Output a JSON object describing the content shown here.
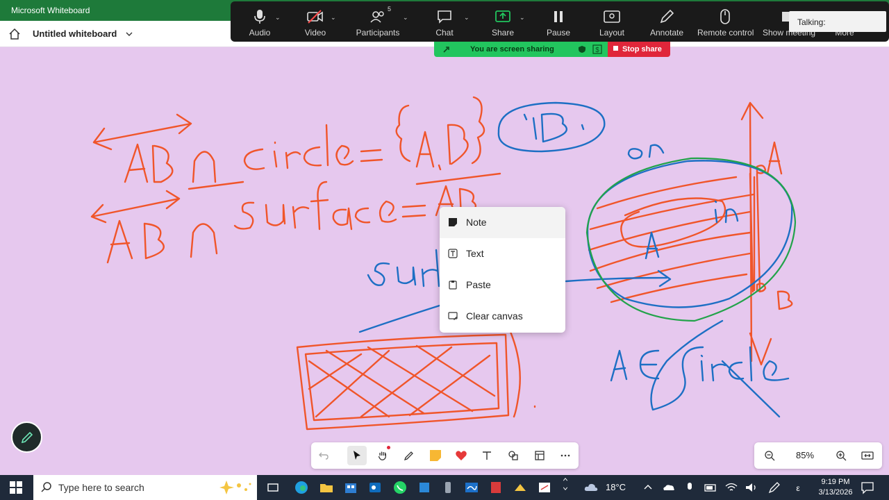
{
  "window": {
    "title": "Microsoft Whiteboard"
  },
  "header": {
    "whiteboard_title": "Untitled whiteboard"
  },
  "zoom_toolbar": {
    "buttons": [
      {
        "label": "Audio",
        "icon": "microphone-icon"
      },
      {
        "label": "Video",
        "icon": "video-off-icon"
      },
      {
        "label": "Participants",
        "icon": "participants-icon",
        "count": "5"
      },
      {
        "label": "Chat",
        "icon": "chat-icon"
      },
      {
        "label": "Share",
        "icon": "share-screen-icon"
      },
      {
        "label": "Pause",
        "icon": "pause-icon"
      },
      {
        "label": "Layout",
        "icon": "layout-icon"
      },
      {
        "label": "Annotate",
        "icon": "pen-icon"
      },
      {
        "label": "Remote control",
        "icon": "mouse-icon"
      },
      {
        "label": "Show meeting",
        "icon": "window-icon"
      },
      {
        "label": "More",
        "icon": "more-icon"
      }
    ],
    "talking_label": "Talking:"
  },
  "share_banner": {
    "status": "You are screen sharing",
    "stop_label": "Stop share"
  },
  "context_menu": {
    "items": [
      {
        "label": "Note",
        "icon": "note-icon"
      },
      {
        "label": "Text",
        "icon": "text-icon"
      },
      {
        "label": "Paste",
        "icon": "paste-icon"
      },
      {
        "label": "Clear canvas",
        "icon": "clear-canvas-icon"
      }
    ]
  },
  "whiteboard_toolbar": {
    "tools": [
      "undo",
      "select",
      "hand",
      "pen",
      "sticky-note",
      "reaction",
      "text",
      "shapes",
      "templates",
      "more"
    ]
  },
  "zoom_control": {
    "level": "85%"
  },
  "taskbar": {
    "search_placeholder": "Type here to search",
    "weather": "18°C",
    "time": "9:19 PM",
    "date": "3/13/2026"
  },
  "colors": {
    "canvas": "#e6c8ee",
    "ink_orange": "#f0552a",
    "ink_blue": "#1d6fc4",
    "ink_green": "#22a34a",
    "zoom_bar": "#1a1a1a",
    "share_green": "#22c55e",
    "stop_red": "#e0263a"
  }
}
